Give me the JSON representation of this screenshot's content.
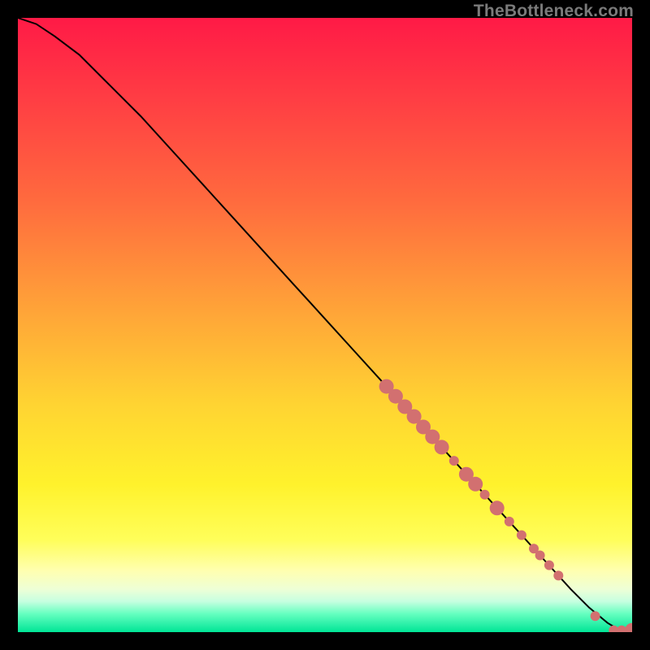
{
  "watermark": "TheBottleneck.com",
  "colors": {
    "point_fill": "#d27070",
    "line_stroke": "#000000",
    "gradient_top": "#ff1a46",
    "gradient_bottom": "#00e596"
  },
  "chart_data": {
    "type": "line",
    "title": "",
    "xlabel": "",
    "ylabel": "",
    "xlim": [
      0,
      100
    ],
    "ylim": [
      0,
      100
    ],
    "grid": false,
    "series": [
      {
        "name": "curve",
        "x": [
          0,
          3,
          6,
          10,
          15,
          20,
          25,
          30,
          35,
          40,
          45,
          50,
          55,
          60,
          65,
          70,
          75,
          80,
          85,
          90,
          93,
          96,
          98,
          100
        ],
        "y": [
          100,
          99,
          97,
          94,
          89,
          84,
          78.5,
          73,
          67.5,
          62,
          56.5,
          51,
          45.5,
          40,
          34.5,
          29,
          23.5,
          18,
          12.5,
          7,
          4,
          1.5,
          0.3,
          0.3
        ]
      }
    ],
    "markers": [
      {
        "x": 60.0,
        "y": 40.0,
        "size": "big"
      },
      {
        "x": 61.5,
        "y": 38.4,
        "size": "big"
      },
      {
        "x": 63.0,
        "y": 36.7,
        "size": "big"
      },
      {
        "x": 64.5,
        "y": 35.1,
        "size": "big"
      },
      {
        "x": 66.0,
        "y": 33.4,
        "size": "big"
      },
      {
        "x": 67.5,
        "y": 31.8,
        "size": "big"
      },
      {
        "x": 69.0,
        "y": 30.1,
        "size": "big"
      },
      {
        "x": 71.0,
        "y": 27.9,
        "size": "small"
      },
      {
        "x": 73.0,
        "y": 25.7,
        "size": "big"
      },
      {
        "x": 74.5,
        "y": 24.1,
        "size": "big"
      },
      {
        "x": 76.0,
        "y": 22.4,
        "size": "small"
      },
      {
        "x": 78.0,
        "y": 20.2,
        "size": "big"
      },
      {
        "x": 80.0,
        "y": 18.0,
        "size": "small"
      },
      {
        "x": 82.0,
        "y": 15.8,
        "size": "small"
      },
      {
        "x": 84.0,
        "y": 13.6,
        "size": "small"
      },
      {
        "x": 85.0,
        "y": 12.5,
        "size": "small"
      },
      {
        "x": 86.5,
        "y": 10.9,
        "size": "small"
      },
      {
        "x": 88.0,
        "y": 9.2,
        "size": "small"
      },
      {
        "x": 94.0,
        "y": 2.6,
        "size": "small"
      },
      {
        "x": 97.0,
        "y": 0.3,
        "size": "small"
      },
      {
        "x": 98.3,
        "y": 0.3,
        "size": "small"
      },
      {
        "x": 100.0,
        "y": 0.3,
        "size": "big"
      }
    ]
  }
}
